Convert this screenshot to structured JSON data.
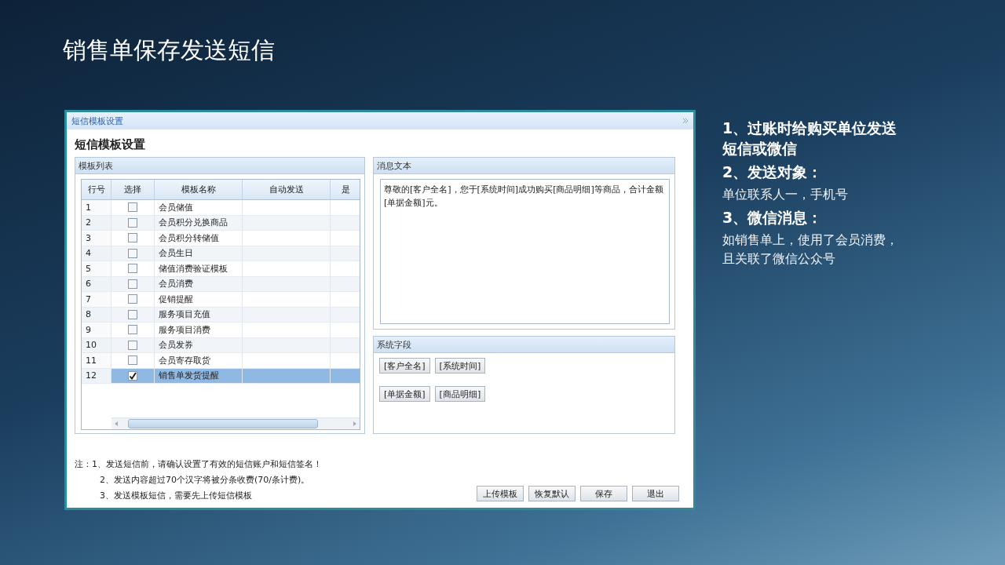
{
  "slide_title": "销售单保存发送短信",
  "dialog": {
    "title": "短信模板设置",
    "heading": "短信模板设置",
    "template_panel": {
      "title": "模板列表",
      "columns": [
        "行号",
        "选择",
        "模板名称",
        "自动发送",
        "是"
      ],
      "rows": [
        {
          "row_no": "1",
          "name": "会员储值",
          "checked": false,
          "selected": false
        },
        {
          "row_no": "2",
          "name": "会员积分兑换商品",
          "checked": false,
          "selected": false
        },
        {
          "row_no": "3",
          "name": "会员积分转储值",
          "checked": false,
          "selected": false
        },
        {
          "row_no": "4",
          "name": "会员生日",
          "checked": false,
          "selected": false
        },
        {
          "row_no": "5",
          "name": "储值消费验证模板",
          "checked": false,
          "selected": false
        },
        {
          "row_no": "6",
          "name": "会员消费",
          "checked": false,
          "selected": false
        },
        {
          "row_no": "7",
          "name": "促销提醒",
          "checked": false,
          "selected": false
        },
        {
          "row_no": "8",
          "name": "服务项目充值",
          "checked": false,
          "selected": false
        },
        {
          "row_no": "9",
          "name": "服务项目消费",
          "checked": false,
          "selected": false
        },
        {
          "row_no": "10",
          "name": "会员发券",
          "checked": false,
          "selected": false
        },
        {
          "row_no": "11",
          "name": "会员寄存取货",
          "checked": false,
          "selected": false
        },
        {
          "row_no": "12",
          "name": "销售单发货提醒",
          "checked": true,
          "selected": true
        }
      ]
    },
    "message_panel": {
      "title": "消息文本",
      "text": "尊敬的[客户全名]，您于[系统时间]成功购买[商品明细]等商品，合计金额[单据金额]元。"
    },
    "fields_panel": {
      "title": "系统字段",
      "buttons": [
        "[客户全名]",
        "[系统时间]",
        "[单据金额]",
        "[商品明细]"
      ]
    },
    "notes_label": "注：",
    "notes": [
      "1、发送短信前，请确认设置了有效的短信账户和短信签名！",
      "2、发送内容超过70个汉字将被分条收费(70/条计费)。",
      "3、发送模板短信，需要先上传短信模板"
    ],
    "buttons": [
      "上传模板",
      "恢复默认",
      "保存",
      "退出"
    ]
  },
  "side_notes": [
    {
      "kind": "heading",
      "text": "1、过账时给购买单位发送短信或微信"
    },
    {
      "kind": "heading",
      "text": "2、发送对象："
    },
    {
      "kind": "body",
      "text": "单位联系人一，手机号"
    },
    {
      "kind": "heading",
      "text": "3、微信消息："
    },
    {
      "kind": "body",
      "text": "如销售单上，使用了会员消费，且关联了微信公众号"
    }
  ]
}
